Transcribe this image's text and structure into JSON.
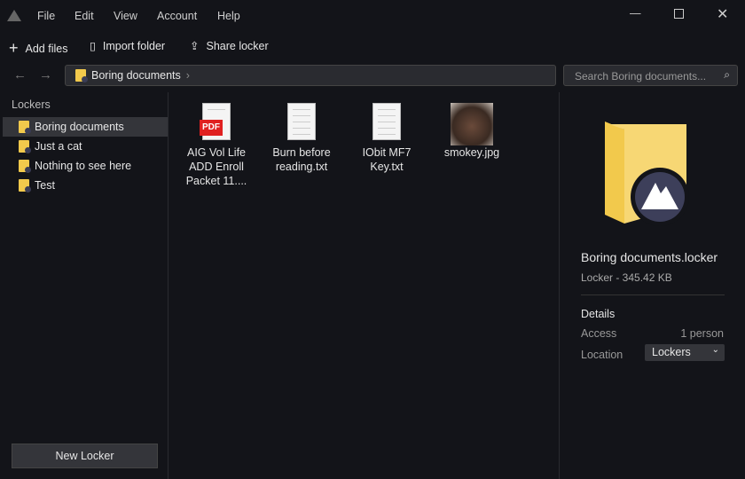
{
  "menu": [
    "File",
    "Edit",
    "View",
    "Account",
    "Help"
  ],
  "toolbar": {
    "add": "Add files",
    "import": "Import folder",
    "share": "Share locker"
  },
  "breadcrumb": "Boring documents",
  "search_placeholder": "Search Boring documents...",
  "sidebar": {
    "title": "Lockers",
    "items": [
      "Boring documents",
      "Just a cat",
      "Nothing to see here",
      "Test"
    ],
    "new_button": "New Locker"
  },
  "files": [
    {
      "name": "AIG Vol Life ADD Enroll Packet 11....",
      "type": "pdf",
      "badge": "PDF"
    },
    {
      "name": "Burn before reading.txt",
      "type": "txt"
    },
    {
      "name": "IObit MF7 Key.txt",
      "type": "txt"
    },
    {
      "name": "smokey.jpg",
      "type": "image"
    }
  ],
  "details": {
    "name": "Boring documents.locker",
    "meta": "Locker - 345.42 KB",
    "heading": "Details",
    "access_label": "Access",
    "access_value": "1 person",
    "location_label": "Location",
    "location_value": "Lockers"
  }
}
